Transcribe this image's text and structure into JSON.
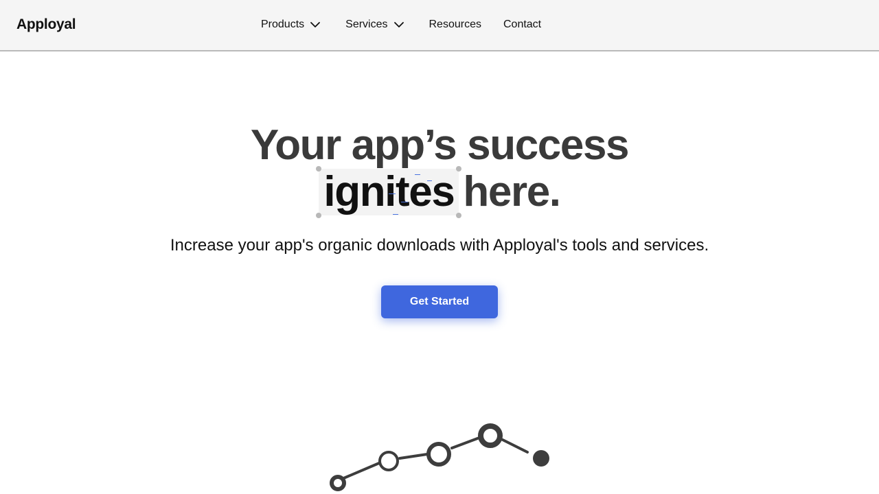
{
  "header": {
    "logo": "Apployal",
    "nav": [
      {
        "label": "Products",
        "has_menu": true
      },
      {
        "label": "Services",
        "has_menu": true
      },
      {
        "label": "Resources",
        "has_menu": false
      },
      {
        "label": "Contact",
        "has_menu": false
      }
    ]
  },
  "hero": {
    "title_line1": "Your app’s success",
    "title_highlight": "ignites",
    "title_rest": "here.",
    "subtitle": "Increase your app's organic downloads with Apployal's tools and services.",
    "cta_label": "Get Started"
  },
  "colors": {
    "accent": "#3f67de",
    "header_bg": "#f5f5f5",
    "title_text": "#3a3a3a",
    "graphic": "#3d3d3d"
  },
  "icons": {
    "nav_menu": "chevron-down-icon"
  }
}
